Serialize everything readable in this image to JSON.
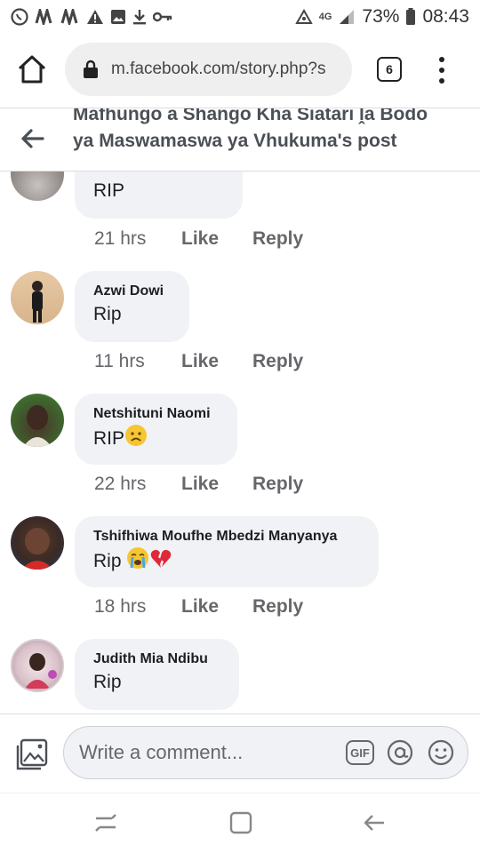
{
  "status_bar": {
    "battery": "73%",
    "time": "08:43",
    "network": "4G",
    "left_icons": [
      "whatsapp-icon",
      "nn-icon",
      "nn-icon",
      "warning-icon",
      "image-icon",
      "download-icon",
      "key-icon"
    ]
  },
  "browser": {
    "url": "m.facebook.com/story.php?s",
    "tab_count": "6"
  },
  "header": {
    "title": "Mafhungo a Shango Kha Siatari ḽa Bodo ya Maswamaswa ya Vhukuma's post"
  },
  "comments": [
    {
      "author": "",
      "text": "RIP",
      "emoji": "",
      "time": "21 hrs",
      "like": "Like",
      "reply": "Reply"
    },
    {
      "author": "Azwi Dowi",
      "text": "Rip",
      "emoji": "",
      "time": "11 hrs",
      "like": "Like",
      "reply": "Reply"
    },
    {
      "author": "Netshituni Naomi",
      "text": "RIP",
      "emoji": "worried-face",
      "time": "22 hrs",
      "like": "Like",
      "reply": "Reply"
    },
    {
      "author": "Tshifhiwa Moufhe Mbedzi Manyanya",
      "text": "Rip ",
      "emoji": "crying-face broken-heart",
      "time": "18 hrs",
      "like": "Like",
      "reply": "Reply"
    },
    {
      "author": "Judith Mia Ndibu",
      "text": "Rip",
      "emoji": "",
      "time": "",
      "like": "",
      "reply": ""
    }
  ],
  "composer": {
    "placeholder": "Write a comment...",
    "gif_label": "GIF"
  },
  "colors": {
    "bubble": "#f0f2f5",
    "meta_text": "#65676b",
    "border": "#dadde1"
  }
}
